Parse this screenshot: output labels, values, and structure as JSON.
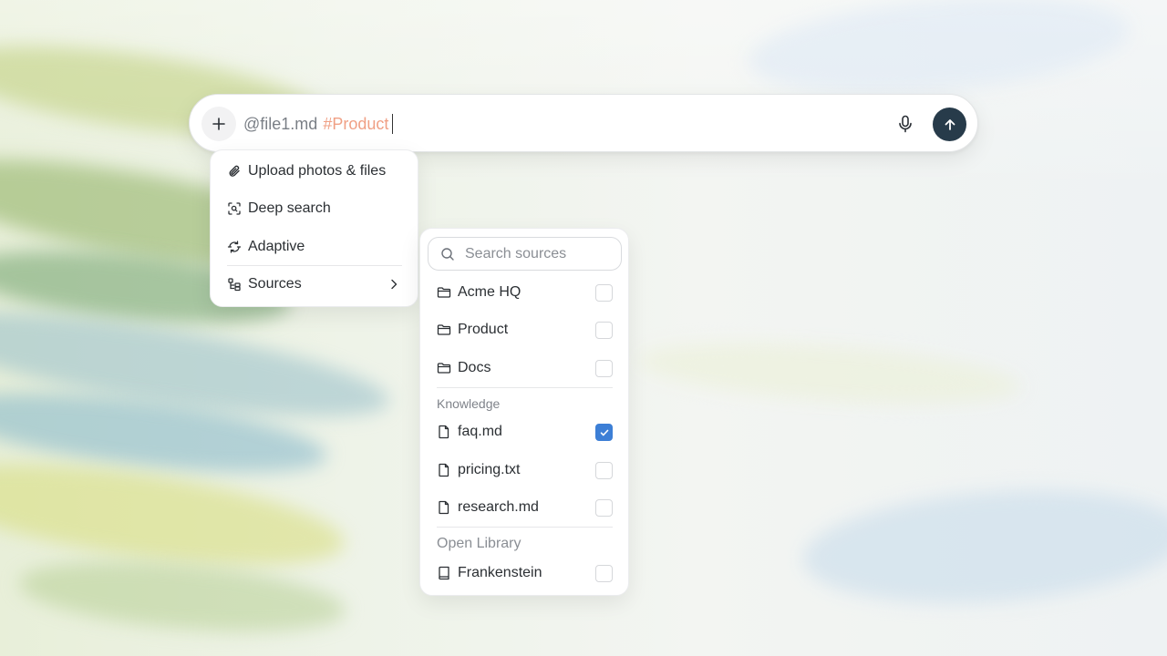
{
  "prompt": {
    "mention": "@file1.md",
    "tag": "#Product",
    "plus_icon": "plus-icon",
    "mic_icon": "microphone-icon",
    "send_icon": "arrow-up-icon"
  },
  "menu": {
    "items": [
      {
        "label": "Upload photos & files",
        "icon": "paperclip-icon"
      },
      {
        "label": "Deep search",
        "icon": "scan-search-icon"
      },
      {
        "label": "Adaptive",
        "icon": "adaptive-icon"
      },
      {
        "label": "Sources",
        "icon": "sources-tree-icon"
      }
    ]
  },
  "sources": {
    "search_placeholder": "Search sources",
    "folders": [
      {
        "label": "Acme HQ",
        "checked": false
      },
      {
        "label": "Product",
        "checked": false
      },
      {
        "label": "Docs",
        "checked": false
      }
    ],
    "knowledge_label": "Knowledge",
    "files": [
      {
        "label": "faq.md",
        "checked": true
      },
      {
        "label": "pricing.txt",
        "checked": false
      },
      {
        "label": "research.md",
        "checked": false
      }
    ],
    "library_label": "Open Library",
    "books": [
      {
        "label": "Frankenstein",
        "checked": false
      }
    ]
  },
  "colors": {
    "send_button": "#273b4a",
    "tag": "#f0a085",
    "checkbox_checked": "#3d7fd6"
  }
}
